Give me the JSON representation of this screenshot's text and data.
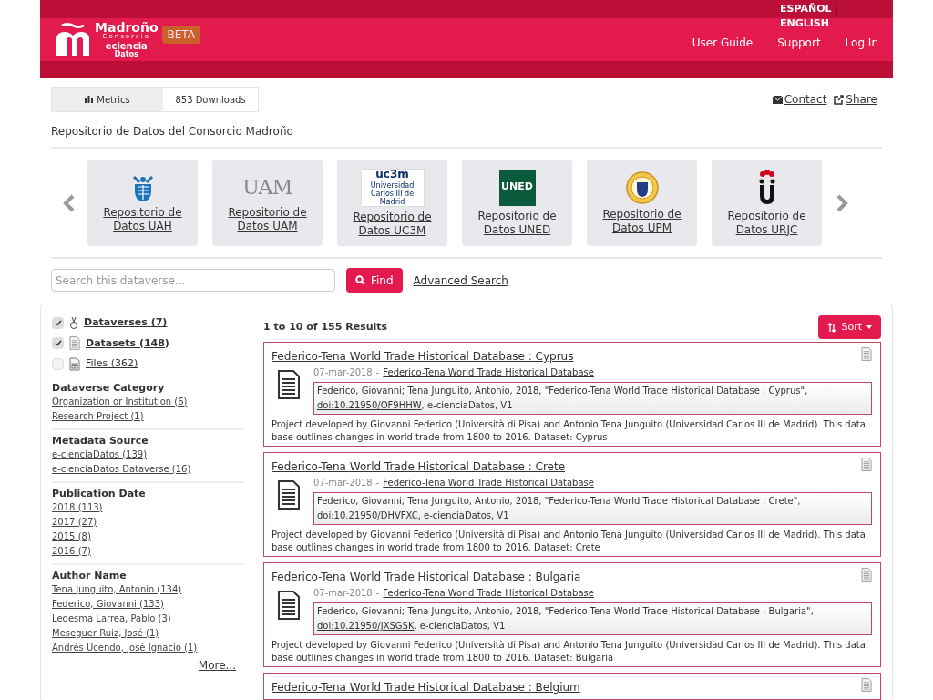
{
  "header": {
    "logo": {
      "name": "Madroño",
      "sub": "Consorcio",
      "brand": "eciencia",
      "brand_sub": "Datos"
    },
    "badge": "BETA",
    "languages": [
      "ESPAÑOL",
      "ENGLISH"
    ],
    "separator": "|",
    "nav": [
      "User Guide",
      "Support",
      "Log In"
    ]
  },
  "metrics": {
    "tabs": [
      {
        "label": "Metrics",
        "selected": true
      },
      {
        "label": "853 Downloads",
        "selected": false
      }
    ]
  },
  "actions": [
    "Contact",
    "Share"
  ],
  "description": "Repositorio de Datos del Consorcio Madroño",
  "carousel": {
    "items": [
      {
        "label": "Repositorio de Datos UAH",
        "kind": "uah"
      },
      {
        "label": "Repositorio de Datos UAM",
        "kind": "uam",
        "logo_text": "UAM"
      },
      {
        "label": "Repositorio de Datos UC3M",
        "kind": "uc3m",
        "logo_text": "uc3m",
        "logo_sub": "Universidad Carlos III de Madrid"
      },
      {
        "label": "Repositorio de Datos UNED",
        "kind": "uned",
        "logo_text": "UNED"
      },
      {
        "label": "Repositorio de Datos UPM",
        "kind": "upm"
      },
      {
        "label": "Repositorio de Datos URJC",
        "kind": "urjc"
      }
    ]
  },
  "search": {
    "placeholder": "Search this dataverse...",
    "button": "Find",
    "advanced": "Advanced Search"
  },
  "facets": {
    "types": [
      {
        "label": "Dataverses (7)",
        "checked": true,
        "kind": "dataverse"
      },
      {
        "label": "Datasets (148)",
        "checked": true,
        "kind": "dataset"
      },
      {
        "label": "Files (362)",
        "checked": false,
        "kind": "file"
      }
    ],
    "groups": [
      {
        "title": "Dataverse Category",
        "items": [
          "Organization or Institution (6)",
          "Research Project (1)"
        ]
      },
      {
        "title": "Metadata Source",
        "items": [
          "e-cienciaDatos (139)",
          "e-cienciaDatos Dataverse (16)"
        ]
      },
      {
        "title": "Publication Date",
        "items": [
          "2018 (113)",
          "2017 (27)",
          "2015 (8)",
          "2016 (7)"
        ]
      },
      {
        "title": "Author Name",
        "items": [
          "Tena Junguito, Antonio (134)",
          "Federico, Giovanni (133)",
          "Ledesma Larrea, Pablo (3)",
          "Meseguer Ruiz, José (1)",
          "Andrés Ucendo, José Ignacio (1)"
        ],
        "more": "More..."
      }
    ]
  },
  "results": {
    "count": "1 to 10 of 155 Results",
    "sort": "Sort",
    "items": [
      {
        "title": "Federico-Tena World Trade Historical Database : Cyprus",
        "date": "07-mar-2018",
        "separator": "-",
        "parent": "Federico-Tena World Trade Historical Database",
        "citation_before": "Federico, Giovanni; Tena Junguito, Antonio, 2018, \"Federico-Tena World Trade Historical Database : Cyprus\",",
        "doi": "doi:10.21950/OF9HHW",
        "citation_after": ", e-cienciaDatos, V1",
        "description": "Project developed by Giovanni Federico (Università di Pisa) and Antonio Tena Junguito (Universidad Carlos III de Madrid). This data base outlines changes in world trade from 1800 to 2016. Dataset: Cyprus"
      },
      {
        "title": "Federico-Tena World Trade Historical Database : Crete",
        "date": "07-mar-2018",
        "separator": "-",
        "parent": "Federico-Tena World Trade Historical Database",
        "citation_before": "Federico, Giovanni; Tena Junguito, Antonio, 2018, \"Federico-Tena World Trade Historical Database : Crete\",",
        "doi": "doi:10.21950/DHVFXC",
        "citation_after": ", e-cienciaDatos, V1",
        "description": "Project developed by Giovanni Federico (Università di Pisa) and Antonio Tena Junguito (Universidad Carlos III de Madrid). This data base outlines changes in world trade from 1800 to 2016. Dataset: Crete"
      },
      {
        "title": "Federico-Tena World Trade Historical Database : Bulgaria",
        "date": "07-mar-2018",
        "separator": "-",
        "parent": "Federico-Tena World Trade Historical Database",
        "citation_before": "Federico, Giovanni; Tena Junguito, Antonio, 2018, \"Federico-Tena World Trade Historical Database : Bulgaria\",",
        "doi": "doi:10.21950/JXSGSK",
        "citation_after": ", e-cienciaDatos, V1",
        "description": "Project developed by Giovanni Federico (Università di Pisa) and Antonio Tena Junguito (Universidad Carlos III de Madrid). This data base outlines changes in world trade from 1800 to 2016. Dataset: Bulgaria"
      },
      {
        "title": "Federico-Tena World Trade Historical Database : Belgium"
      }
    ]
  }
}
